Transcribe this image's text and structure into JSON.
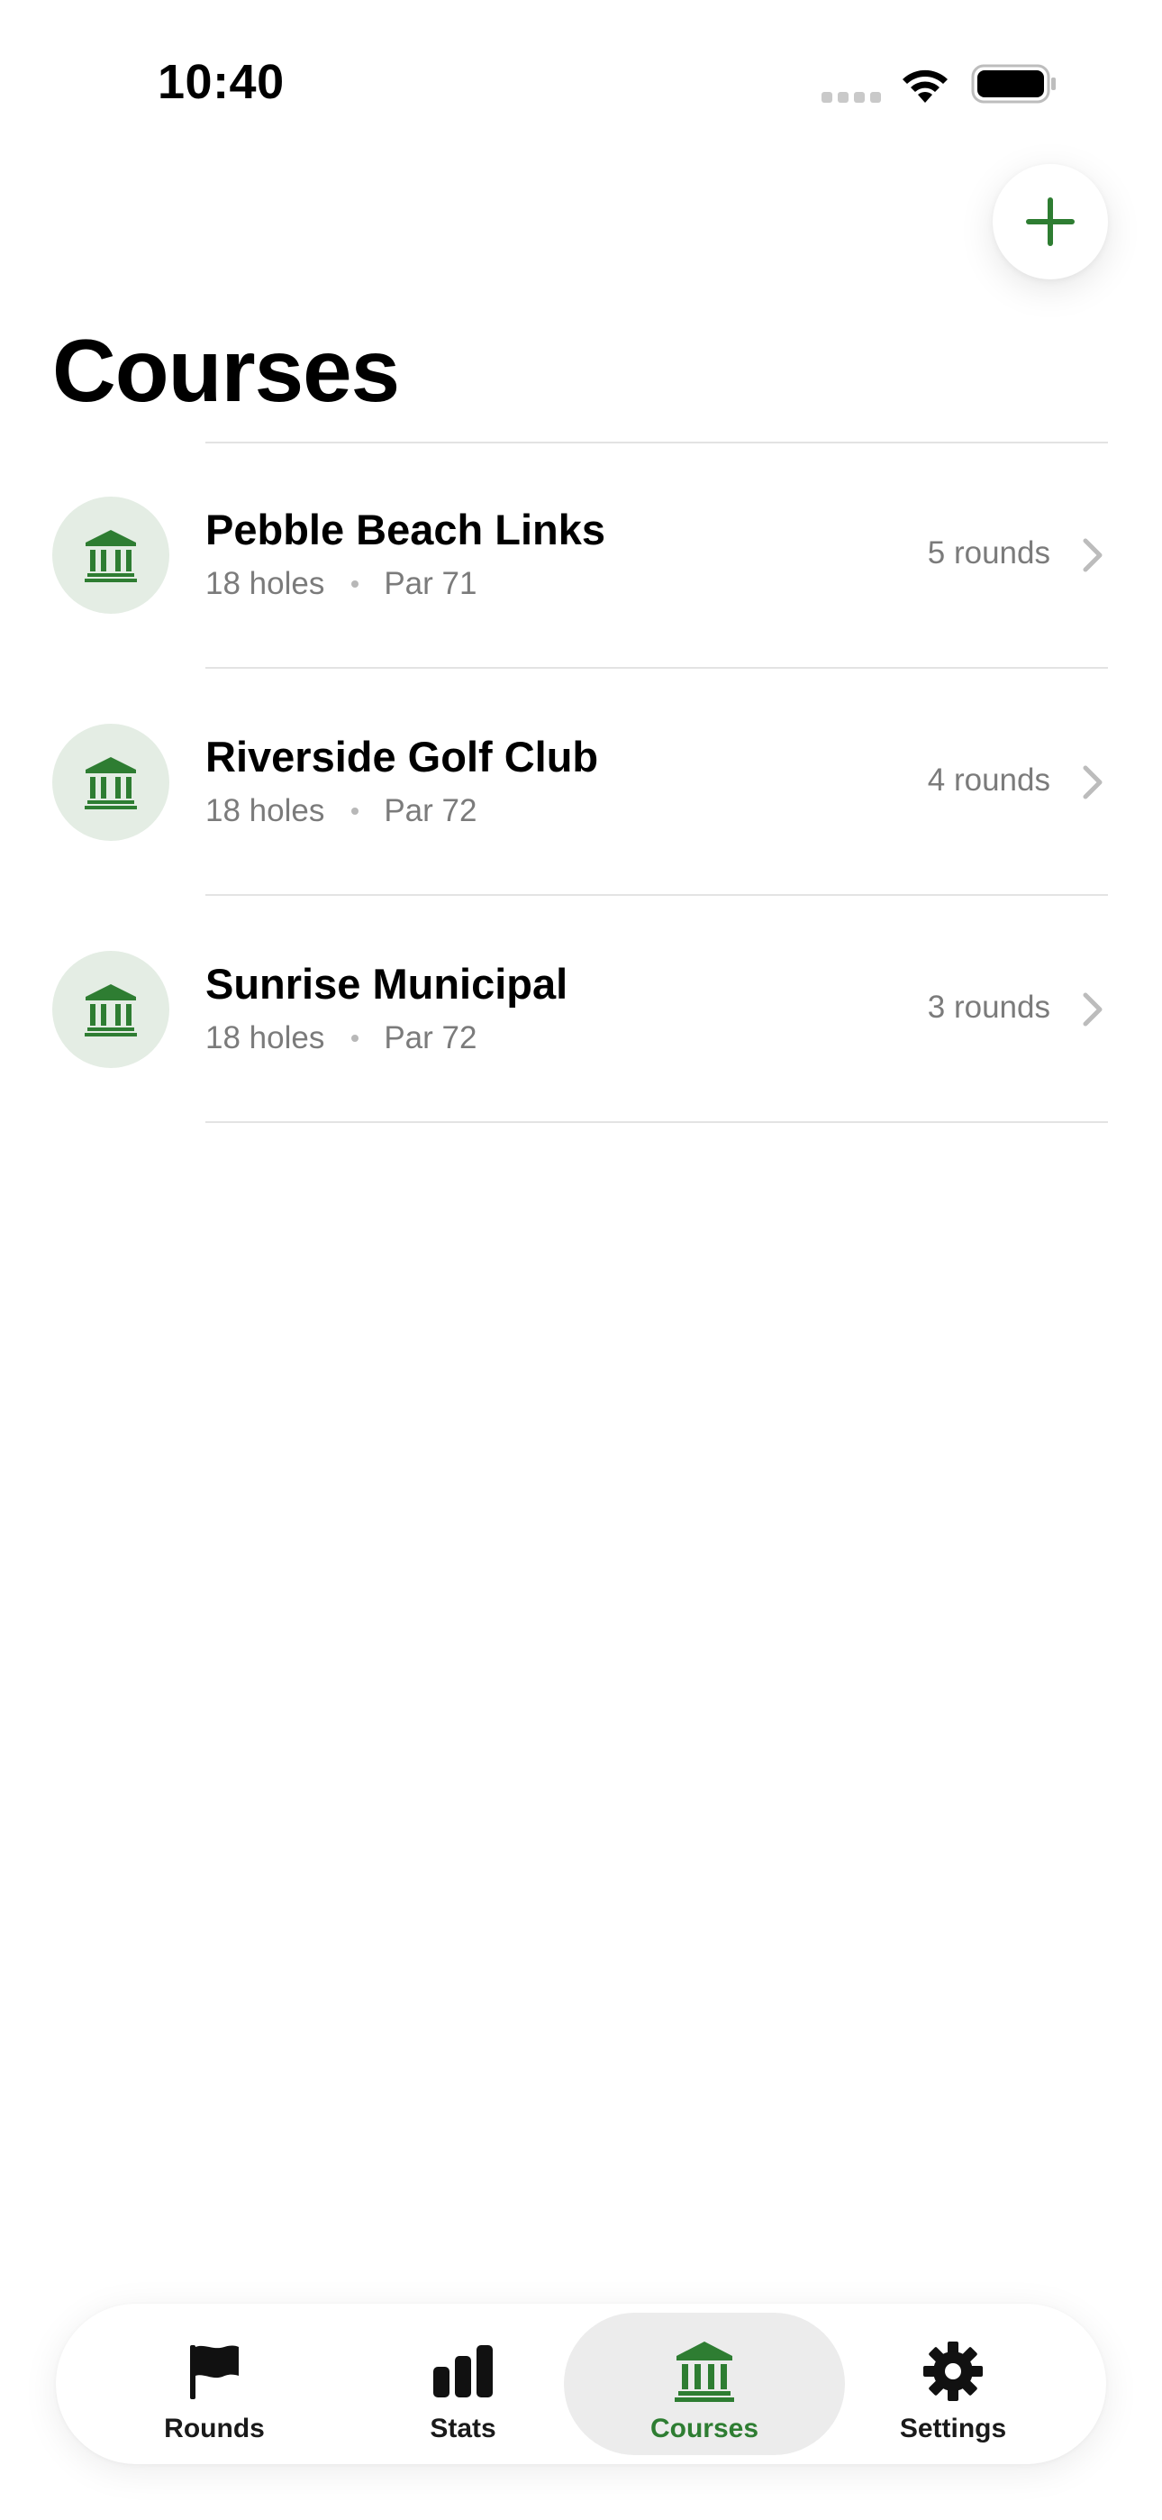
{
  "status_bar": {
    "time": "10:40"
  },
  "header": {
    "title": "Courses",
    "add_icon": "plus-icon"
  },
  "colors": {
    "accent": "#2E7D32",
    "avatar_bg": "#E4EDE4",
    "secondary_text": "#7B7B7B",
    "separator": "#E3E3E3",
    "active_tab_bg": "#ECECEC"
  },
  "courses": [
    {
      "name": "Pebble Beach Links",
      "holes": "18 holes",
      "par": "Par 71",
      "rounds": "5 rounds",
      "icon": "building-columns-icon"
    },
    {
      "name": "Riverside Golf Club",
      "holes": "18 holes",
      "par": "Par 72",
      "rounds": "4 rounds",
      "icon": "building-columns-icon"
    },
    {
      "name": "Sunrise Municipal",
      "holes": "18 holes",
      "par": "Par 72",
      "rounds": "3 rounds",
      "icon": "building-columns-icon"
    }
  ],
  "tab_bar": {
    "tabs": [
      {
        "label": "Rounds",
        "icon": "flag-icon",
        "active": false
      },
      {
        "label": "Stats",
        "icon": "bar-chart-icon",
        "active": false
      },
      {
        "label": "Courses",
        "icon": "building-columns-icon",
        "active": true
      },
      {
        "label": "Settings",
        "icon": "gear-icon",
        "active": false
      }
    ]
  }
}
